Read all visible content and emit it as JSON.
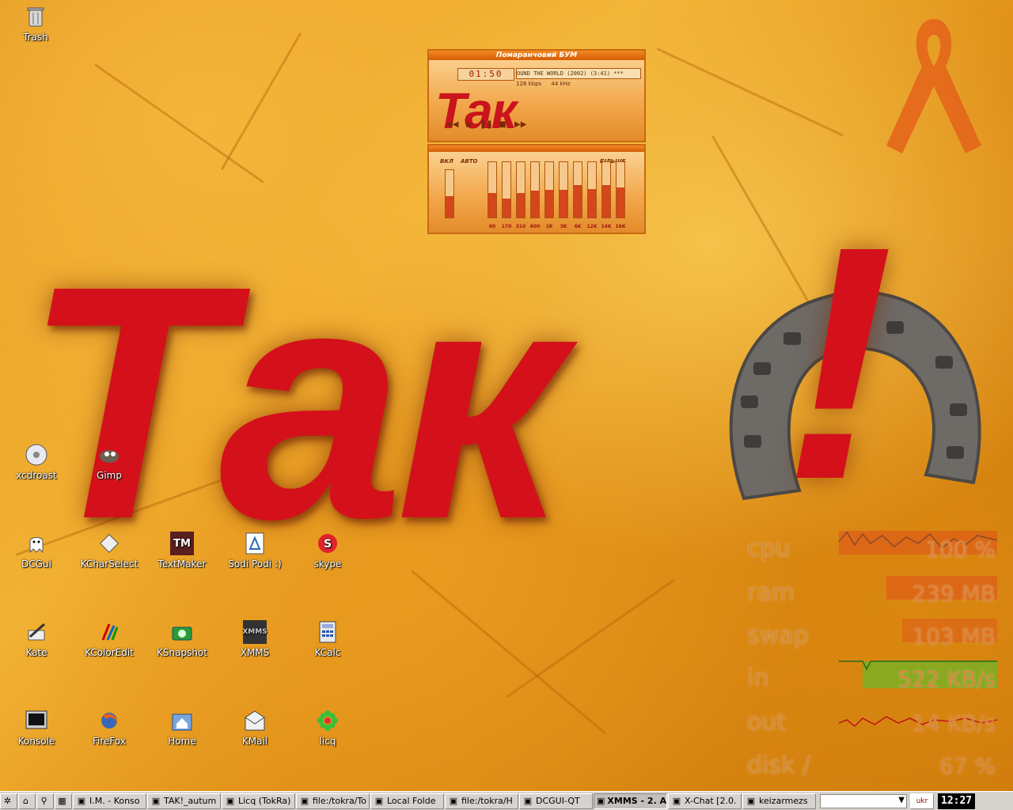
{
  "desktop": {
    "icons": [
      {
        "id": "trash",
        "label": "Trash"
      },
      {
        "id": "xcdroast",
        "label": "xcdroast"
      },
      {
        "id": "gimp",
        "label": "Gimp"
      },
      {
        "id": "dcgui",
        "label": "DCGui"
      },
      {
        "id": "kcharselect",
        "label": "KCharSelect"
      },
      {
        "id": "textmaker",
        "label": "TextMaker"
      },
      {
        "id": "sodipodi",
        "label": "Sodi Podi :)"
      },
      {
        "id": "skype",
        "label": "skype"
      },
      {
        "id": "kate",
        "label": "Kate"
      },
      {
        "id": "kcoloredit",
        "label": "KColorEdit"
      },
      {
        "id": "ksnapshot",
        "label": "KSnapshot"
      },
      {
        "id": "xmms",
        "label": "XMMS"
      },
      {
        "id": "kcalc",
        "label": "KCalc"
      },
      {
        "id": "konsole",
        "label": "Konsole"
      },
      {
        "id": "firefox",
        "label": "FireFox"
      },
      {
        "id": "home",
        "label": "Home"
      },
      {
        "id": "kmail",
        "label": "KMail"
      },
      {
        "id": "licq",
        "label": "licq"
      }
    ]
  },
  "wallpaper": {
    "logo_text": "Так",
    "logo_mark": "!"
  },
  "xmms_player": {
    "title": "Помаранчовий БУМ",
    "time": "01:50",
    "song": "OUND THE WORLD (2002) (3:41) *** ",
    "bitrate": "128 kbps",
    "samplerate": "44 kHz",
    "logo": "Так",
    "eq_on": "ВКЛ",
    "eq_auto": "АВТО",
    "eq_more": "БІЛЬШЕ",
    "eq_bands": [
      {
        "freq": "60",
        "level": 0.45
      },
      {
        "freq": "170",
        "level": 0.35
      },
      {
        "freq": "310",
        "level": 0.45
      },
      {
        "freq": "600",
        "level": 0.48
      },
      {
        "freq": "1K",
        "level": 0.5
      },
      {
        "freq": "3K",
        "level": 0.5
      },
      {
        "freq": "6K",
        "level": 0.58
      },
      {
        "freq": "12K",
        "level": 0.52
      },
      {
        "freq": "14K",
        "level": 0.58
      },
      {
        "freq": "16K",
        "level": 0.55
      }
    ]
  },
  "sysmon": [
    {
      "label": "cpu",
      "value": "100 %"
    },
    {
      "label": "ram",
      "value": "239 MB"
    },
    {
      "label": "swap",
      "value": "103 MB"
    },
    {
      "label": "in",
      "value": "522 KB/s"
    },
    {
      "label": "out",
      "value": "14 KB/s"
    },
    {
      "label": "disk /",
      "value": "67 %"
    }
  ],
  "taskbar": {
    "tasks": [
      {
        "label": "I.M. - Konso",
        "active": false
      },
      {
        "label": "TAK!_autum",
        "active": false
      },
      {
        "label": "Licq (TokRa)",
        "active": false
      },
      {
        "label": "file:/tokra/To",
        "active": false
      },
      {
        "label": "Local Folde",
        "active": false
      },
      {
        "label": "file:/tokra/H",
        "active": false
      },
      {
        "label": "DCGUI-QT",
        "active": false
      },
      {
        "label": "XMMS - 2. A",
        "active": true
      },
      {
        "label": "X-Chat [2.0.",
        "active": false
      },
      {
        "label": "keizarmezs",
        "active": false
      }
    ],
    "lang": "ukr",
    "clock": "12:27"
  },
  "colors": {
    "logo_red": "#d4111b",
    "taskbar": "#d6d3ce"
  }
}
